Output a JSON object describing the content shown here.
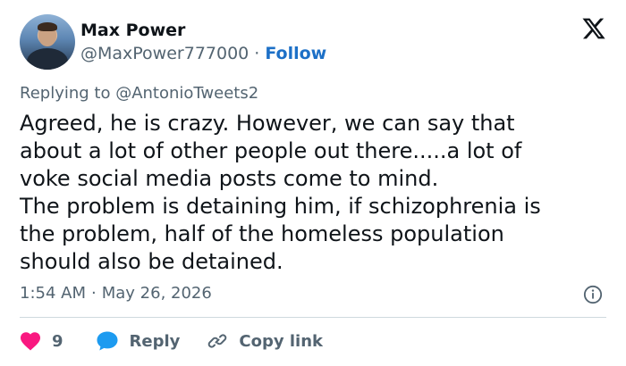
{
  "author": {
    "display_name": "Max Power",
    "handle": "@MaxPower777000",
    "separator": "·",
    "follow_label": "Follow"
  },
  "reply_context": {
    "text": "Replying to @AntonioTweets2"
  },
  "tweet": {
    "text": "Agreed, he is crazy. However, we can say that\nabout a lot of other people out there.....a lot of\nvoke social media posts come to mind.\nThe problem is detaining him, if schizophrenia is\nthe problem, half of the homeless population\nshould also be detained."
  },
  "meta": {
    "time": "1:54 AM",
    "separator": "·",
    "date": "May 26, 2026"
  },
  "actions": {
    "like_count": "9",
    "reply_label": "Reply",
    "copy_link_label": "Copy link"
  },
  "icons": {
    "logo": "x-logo-icon",
    "info": "info-icon",
    "like": "heart-icon",
    "reply": "speech-bubble-icon",
    "copy_link": "link-icon"
  },
  "colors": {
    "follow": "#1d70c7",
    "heart": "#f91880",
    "reply_bubble": "#1d9bf0",
    "muted_text": "#536471",
    "primary_text": "#0f1419"
  }
}
